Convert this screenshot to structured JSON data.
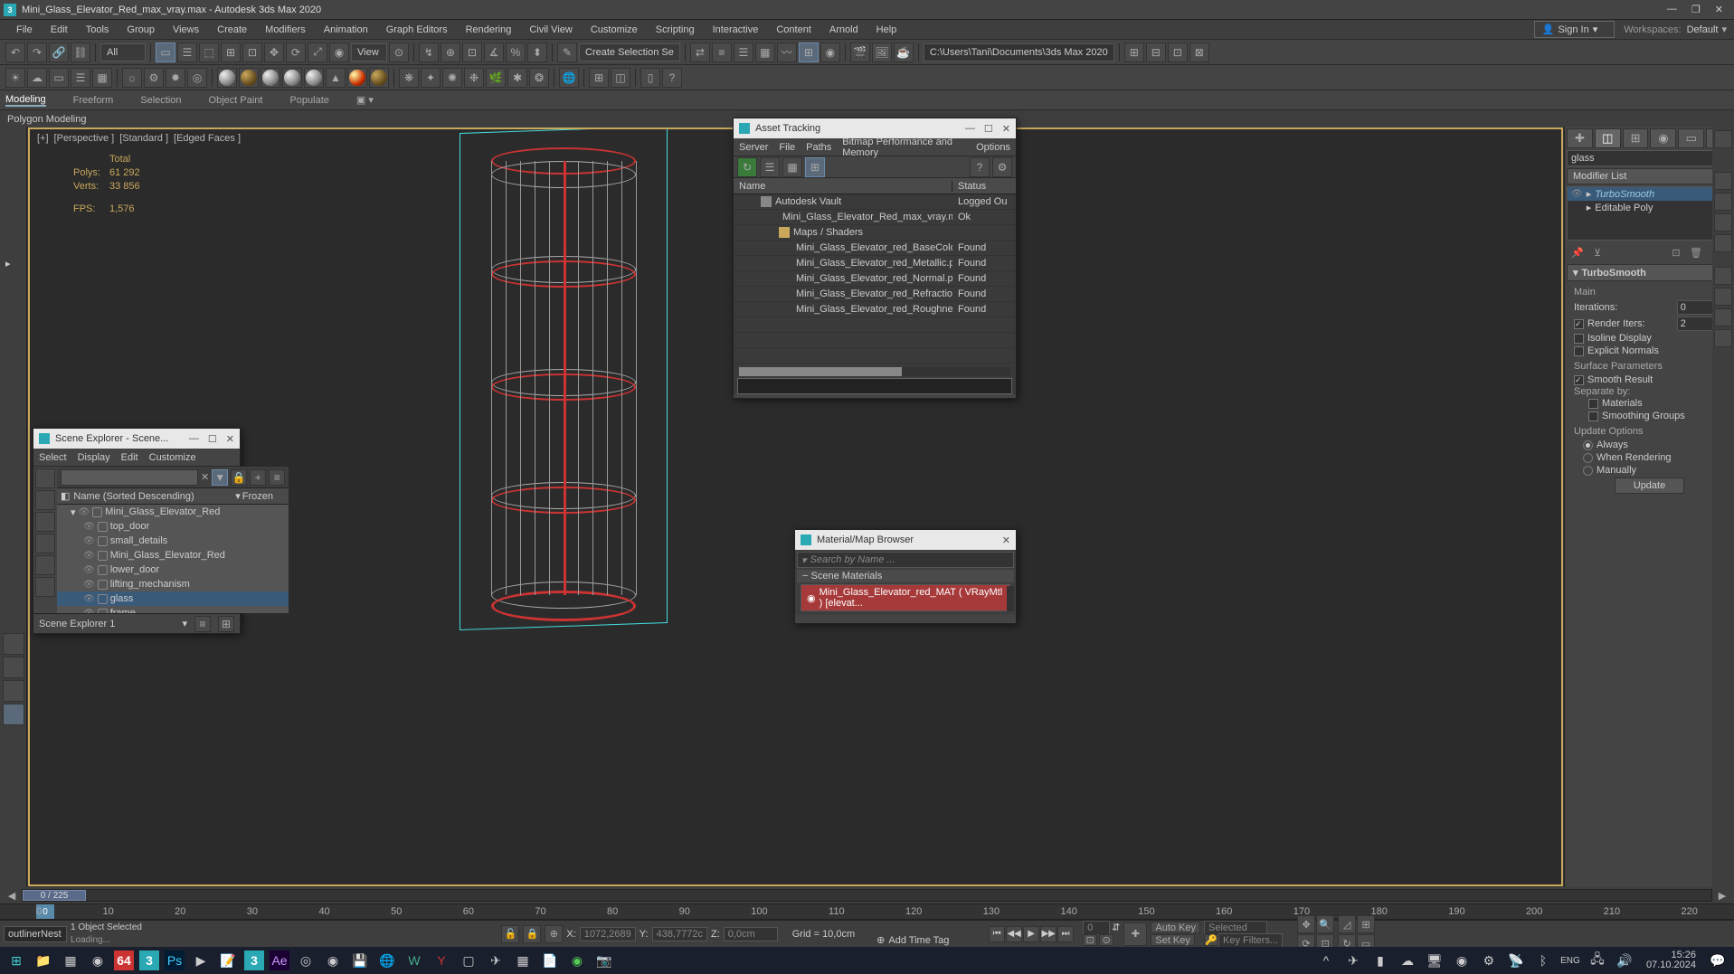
{
  "title_bar": {
    "app_icon_text": "3",
    "title": "Mini_Glass_Elevator_Red_max_vray.max - Autodesk 3ds Max 2020"
  },
  "menu": {
    "items": [
      "File",
      "Edit",
      "Tools",
      "Group",
      "Views",
      "Create",
      "Modifiers",
      "Animation",
      "Graph Editors",
      "Rendering",
      "Civil View",
      "Customize",
      "Scripting",
      "Interactive",
      "Content",
      "Arnold",
      "Help"
    ],
    "sign_in": "Sign In",
    "workspace_label": "Workspaces:",
    "workspace_value": "Default"
  },
  "toolbar1": {
    "all_dropdown": "All",
    "view_dropdown": "View",
    "create_sel_dropdown": "Create Selection Se",
    "path_field": "C:\\Users\\Tani\\Documents\\3ds Max 2020"
  },
  "ribbon": {
    "tabs": [
      "Modeling",
      "Freeform",
      "Selection",
      "Object Paint",
      "Populate"
    ],
    "sub_label": "Polygon Modeling"
  },
  "viewport": {
    "labels": [
      "[+]",
      "[Perspective ]",
      "[Standard ]",
      "[Edged Faces ]"
    ],
    "stats": {
      "total_label": "Total",
      "polys_label": "Polys:",
      "polys_value": "61 292",
      "verts_label": "Verts:",
      "verts_value": "33 856",
      "fps_label": "FPS:",
      "fps_value": "1,576"
    }
  },
  "asset_tracking": {
    "title": "Asset Tracking",
    "menu": [
      "Server",
      "File",
      "Paths",
      "Bitmap Performance and Memory",
      "Options"
    ],
    "columns": {
      "name": "Name",
      "status": "Status"
    },
    "rows": [
      {
        "indent": 1,
        "icon": "vault",
        "name": "Autodesk Vault",
        "status": "Logged Ou"
      },
      {
        "indent": 2,
        "icon": "max",
        "name": "Mini_Glass_Elevator_Red_max_vray.max",
        "status": "Ok"
      },
      {
        "indent": 2,
        "icon": "folder",
        "name": "Maps / Shaders",
        "status": ""
      },
      {
        "indent": 3,
        "icon": "png",
        "name": "Mini_Glass_Elevator_red_BaseColor.png",
        "status": "Found"
      },
      {
        "indent": 3,
        "icon": "png",
        "name": "Mini_Glass_Elevator_red_Metallic.png",
        "status": "Found"
      },
      {
        "indent": 3,
        "icon": "png",
        "name": "Mini_Glass_Elevator_red_Normal.png",
        "status": "Found"
      },
      {
        "indent": 3,
        "icon": "png",
        "name": "Mini_Glass_Elevator_red_Refraction.png",
        "status": "Found"
      },
      {
        "indent": 3,
        "icon": "png",
        "name": "Mini_Glass_Elevator_red_Roughness.png",
        "status": "Found"
      }
    ]
  },
  "scene_explorer": {
    "title": "Scene Explorer - Scene...",
    "menu": [
      "Select",
      "Display",
      "Edit",
      "Customize"
    ],
    "header_name": "Name (Sorted Descending)",
    "header_frozen": "Frozen",
    "items": [
      {
        "level": 0,
        "expanded": true,
        "name": "Mini_Glass_Elevator_Red",
        "selected": false
      },
      {
        "level": 1,
        "name": "top_door",
        "selected": false
      },
      {
        "level": 1,
        "name": "small_details",
        "selected": false
      },
      {
        "level": 1,
        "name": "Mini_Glass_Elevator_Red",
        "selected": false
      },
      {
        "level": 1,
        "name": "lower_door",
        "selected": false
      },
      {
        "level": 1,
        "name": "lifting_mechanism",
        "selected": false
      },
      {
        "level": 1,
        "name": "glass",
        "selected": true
      },
      {
        "level": 1,
        "name": "frame",
        "selected": false
      }
    ],
    "bottom_label": "Scene Explorer 1"
  },
  "material_browser": {
    "title": "Material/Map Browser",
    "search_placeholder": "Search by Name ...",
    "group_label": "Scene Materials",
    "item": "Mini_Glass_Elevator_red_MAT ( VRayMtl ) [elevat..."
  },
  "command_panel": {
    "name_field": "glass",
    "modifier_list_label": "Modifier List",
    "stack": [
      {
        "name": "TurboSmooth",
        "italic": true,
        "selected": true,
        "expandable": true
      },
      {
        "name": "Editable Poly",
        "italic": false,
        "selected": false,
        "expandable": true
      }
    ],
    "rollout": {
      "title": "TurboSmooth",
      "main_label": "Main",
      "iterations_label": "Iterations:",
      "iterations_value": "0",
      "render_iters_label": "Render Iters:",
      "render_iters_checked": true,
      "render_iters_value": "2",
      "isoline_label": "Isoline Display",
      "explicit_label": "Explicit Normals",
      "surface_label": "Surface Parameters",
      "smooth_result_label": "Smooth Result",
      "smooth_result_checked": true,
      "separate_label": "Separate by:",
      "materials_label": "Materials",
      "smoothing_groups_label": "Smoothing Groups",
      "update_label": "Update Options",
      "always_label": "Always",
      "when_rendering_label": "When Rendering",
      "manually_label": "Manually",
      "update_btn": "Update"
    }
  },
  "time": {
    "slider_label": "0 / 225",
    "ruler_marks": [
      "0",
      "10",
      "20",
      "30",
      "40",
      "50",
      "60",
      "70",
      "80",
      "90",
      "100",
      "110",
      "120",
      "130",
      "140",
      "150",
      "160",
      "170",
      "180",
      "190",
      "200",
      "210",
      "220"
    ]
  },
  "status": {
    "script_input": "outlinerNest",
    "selection_info": "1 Object Selected",
    "loading": "Loading...",
    "x_label": "X:",
    "x_value": "1072,2689",
    "y_label": "Y:",
    "y_value": "438,7772c",
    "z_label": "Z:",
    "z_value": "0,0cm",
    "grid_label": "Grid = 10,0cm",
    "add_time_tag": "Add Time Tag",
    "auto_key": "Auto Key",
    "set_key": "Set Key",
    "selected_drop": "Selected",
    "key_filters": "Key Filters...",
    "frame_field": "0"
  },
  "taskbar": {
    "lang": "ENG",
    "time": "15:26",
    "date": "07.10.2024"
  }
}
